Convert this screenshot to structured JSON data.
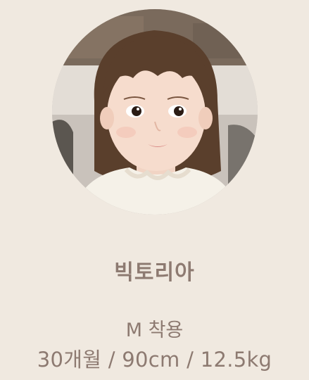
{
  "model": {
    "name": "빅토리아",
    "size_worn": "M 착용",
    "stats": "30개월 / 90cm / 12.5kg"
  },
  "colors": {
    "background": "#f0e9e0",
    "text": "#8d7a71"
  },
  "photo": {
    "subject": "child-portrait"
  }
}
